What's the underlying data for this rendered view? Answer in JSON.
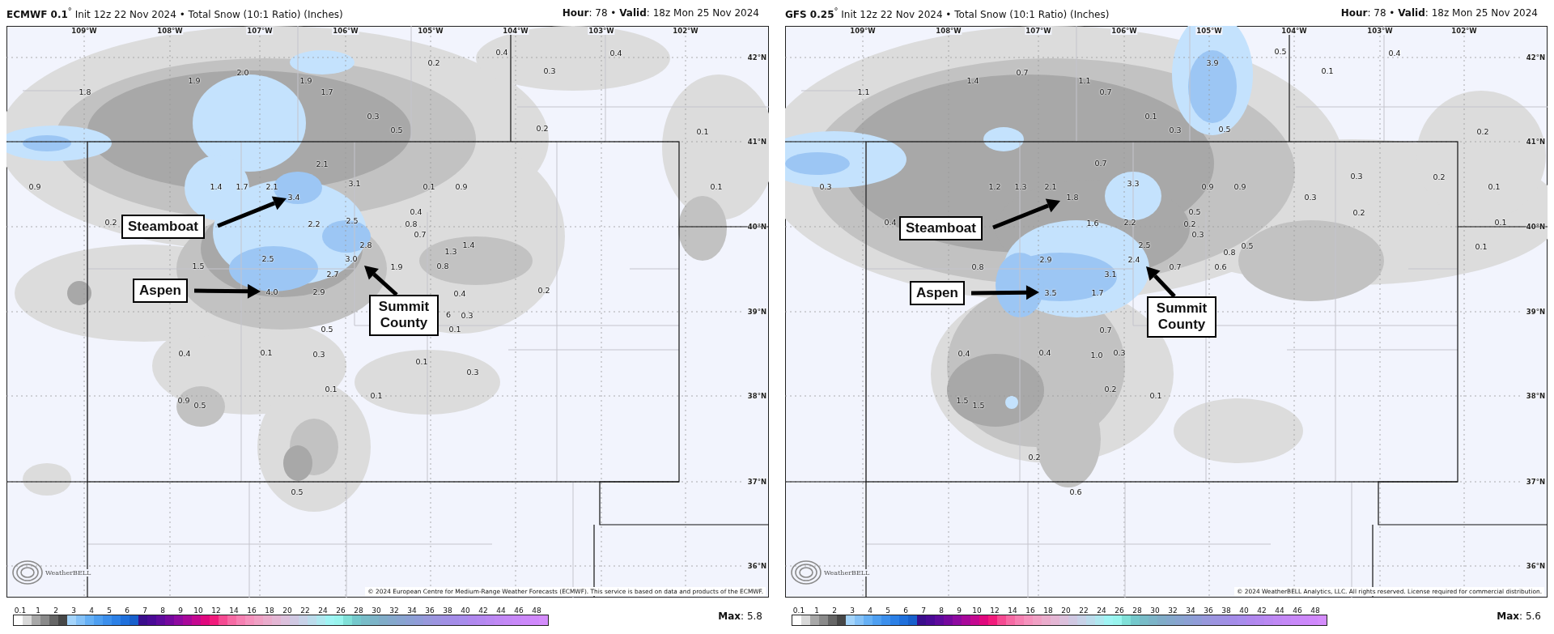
{
  "panels": [
    {
      "title": "**ECMWF 0.1**$^{°}$ Init 12z 22 Nov 2024 • Total Snow (10:1 Ratio) (Inches)",
      "valid": "**Hour**: 78 • **Valid**: 18z Mon 25 Nov 2024",
      "longitudes": [
        "109°W",
        "108°W",
        "107°W",
        "106°W",
        "105°W",
        "104°W",
        "103°W",
        "102°W"
      ],
      "latitudes": [
        "42°N",
        "41°N",
        "40°N",
        "39°N",
        "38°N",
        "37°N",
        "36°N"
      ],
      "value_labels": [
        "0.4",
        "0.4",
        "0.2",
        "2.0",
        "0.3",
        "1.9",
        "1.9",
        "1.8",
        "1.7",
        "0.3",
        "0.5",
        "0.2",
        "0.1",
        "2.1",
        "0.9",
        "1.4",
        "1.7",
        "2.1",
        "3.1",
        "0.1",
        "0.9",
        "0.1",
        "3.4",
        "0.4",
        "0.2",
        "2.2",
        "2.5",
        "0.8",
        "0.7",
        "2.8",
        "1.4",
        "1.3",
        "2.5",
        "3.0",
        "1.5",
        "1.9",
        "0.8",
        "2.7",
        "4.0",
        "2.9",
        "0.4",
        "0.2",
        "6",
        "0.3",
        "0.5",
        "0.1",
        "0.4",
        "0.1",
        "0.3",
        "0.1",
        "0.3",
        "0.1",
        "0.1",
        "0.9",
        "0.5",
        "0.5"
      ],
      "callouts": [
        "Steamboat",
        "Aspen",
        "Summit County"
      ],
      "logo": "WeatherBELL",
      "copyright": "© 2024 European Centre for Medium-Range Weather Forecasts (ECMWF). This service is based on data and products of the ECMWF.",
      "scale_ticks": [
        "0.1",
        "1",
        "2",
        "3",
        "4",
        "5",
        "6",
        "7",
        "8",
        "9",
        "10",
        "12",
        "14",
        "16",
        "18",
        "20",
        "22",
        "24",
        "26",
        "28",
        "30",
        "32",
        "34",
        "36",
        "38",
        "40",
        "42",
        "44",
        "46",
        "48"
      ],
      "max": "**Max**: 5.8"
    },
    {
      "title": "**GFS 0.25**$^{°}$ Init 12z 22 Nov 2024 • Total Snow (10:1 Ratio) (Inches)",
      "valid": "**Hour**: 78 • **Valid**: 18z Mon 25 Nov 2024",
      "longitudes": [
        "109°W",
        "108°W",
        "107°W",
        "106°W",
        "105°W",
        "104°W",
        "103°W",
        "102°W"
      ],
      "latitudes": [
        "42°N",
        "41°N",
        "40°N",
        "39°N",
        "38°N",
        "37°N",
        "36°N"
      ],
      "value_labels": [
        "0.5",
        "0.4",
        "3.9",
        "0.7",
        "0.1",
        "1.4",
        "1.1",
        "1.1",
        "0.7",
        "0.1",
        "0.3",
        "0.5",
        "0.2",
        "0.7",
        "0.3",
        "0.2",
        "0.3",
        "1.2",
        "1.3",
        "2.1",
        "3.3",
        "0.9",
        "0.9",
        "0.1",
        "1.8",
        "0.3",
        "0.5",
        "0.2",
        "0.4",
        "1.6",
        "2.2",
        "0.2",
        "0.1",
        "0.3",
        "2.5",
        "0.5",
        "0.1",
        "0.8",
        "2.9",
        "2.4",
        "0.8",
        "0.7",
        "0.6",
        "3.1",
        "3.5",
        "1.7",
        "0.7",
        "0.4",
        "0.4",
        "1.0",
        "0.3",
        "0.2",
        "0.1",
        "1.5",
        "1.5",
        "0.2",
        "0.6"
      ],
      "callouts": [
        "Steamboat",
        "Aspen",
        "Summit County"
      ],
      "logo": "WeatherBELL",
      "copyright": "© 2024 WeatherBELL Analytics, LLC. All rights reserved. License required for commercial distribution.",
      "scale_ticks": [
        "0.1",
        "1",
        "2",
        "3",
        "4",
        "5",
        "6",
        "7",
        "8",
        "9",
        "10",
        "12",
        "14",
        "16",
        "18",
        "20",
        "22",
        "24",
        "26",
        "28",
        "30",
        "32",
        "34",
        "36",
        "38",
        "40",
        "42",
        "44",
        "46",
        "48"
      ],
      "max": "**Max**: 5.6"
    }
  ]
}
